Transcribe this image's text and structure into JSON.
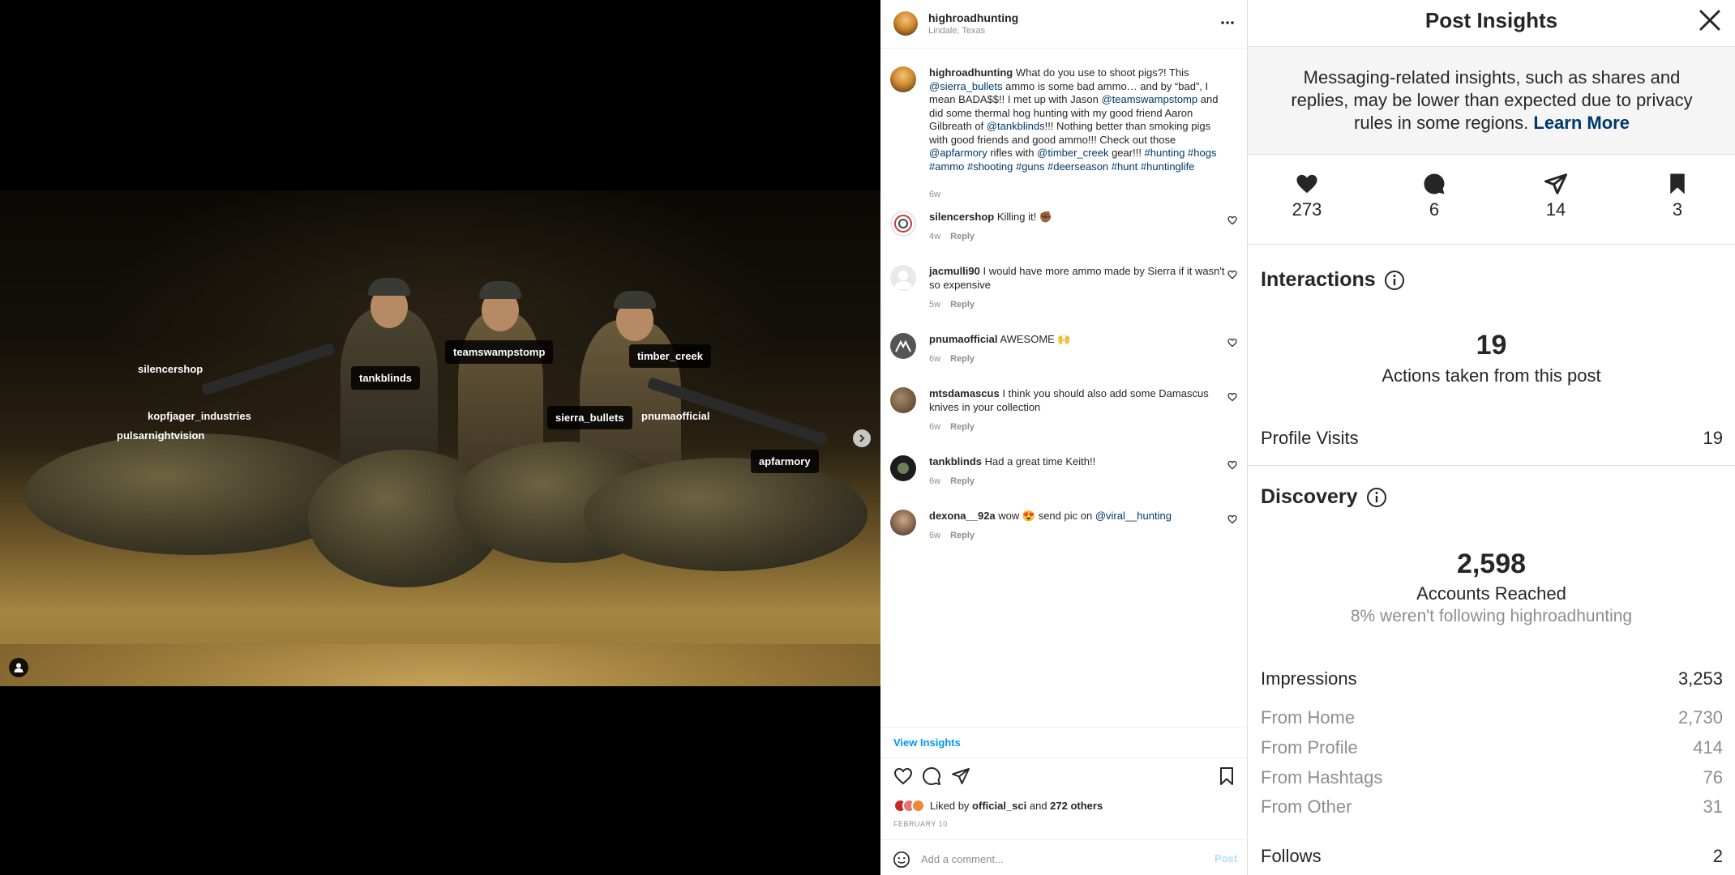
{
  "photo": {
    "tags": [
      {
        "label": "silencershop"
      },
      {
        "label": "tankblinds"
      },
      {
        "label": "teamswampstomp"
      },
      {
        "label": "timber_creek"
      },
      {
        "label": "kopfjager_industries"
      },
      {
        "label": "pulsarnightvision"
      },
      {
        "label": "sierra_bullets"
      },
      {
        "label": "pnumaofficial"
      },
      {
        "label": "apfarmory"
      }
    ],
    "next_icon": "chevron-right-icon",
    "user_tag_icon": "person-icon"
  },
  "post": {
    "username": "highroadhunting",
    "location": "Lindale, Texas",
    "more_icon": "more-horizontal-icon",
    "caption": {
      "username": "highroadhunting",
      "parts": [
        {
          "t": " What do you use to shoot pigs?! This "
        },
        {
          "t": "@sierra_bullets",
          "m": true
        },
        {
          "t": " ammo is some bad ammo… and by “bad”, I mean BADA$$!! I met up with Jason "
        },
        {
          "t": "@teamswampstomp",
          "m": true
        },
        {
          "t": " and did some thermal hog hunting with my good friend Aaron Gilbreath of "
        },
        {
          "t": "@tankblinds",
          "m": true
        },
        {
          "t": "!!! Nothing better than smoking pigs with good friends and good ammo!!! Check out those "
        },
        {
          "t": "@apfarmory",
          "m": true
        },
        {
          "t": " rifles with "
        },
        {
          "t": "@timber_creek",
          "m": true
        },
        {
          "t": " gear!!! "
        },
        {
          "t": "#hunting #hogs #ammo #shooting #guns #deerseason #hunt #huntinglife",
          "m": true
        }
      ],
      "time": "6w"
    },
    "comments": [
      {
        "user": "silencershop",
        "text": " Killing it! ✊🏾",
        "time": "4w",
        "reply": "Reply"
      },
      {
        "user": "jacmulli90",
        "text": " I would have more ammo made by Sierra if it wasn't so expensive",
        "time": "5w",
        "reply": "Reply"
      },
      {
        "user": "pnumaofficial",
        "text": " AWESOME 🙌",
        "time": "6w",
        "reply": "Reply"
      },
      {
        "user": "mtsdamascus",
        "text": " I think you should also add some Damascus knives in your collection",
        "time": "6w",
        "reply": "Reply"
      },
      {
        "user": "tankblinds",
        "text": " Had a great time Keith!!",
        "time": "6w",
        "reply": "Reply"
      },
      {
        "user": "dexona__92a",
        "text": " wow 😍 send pic on ",
        "mention": "@viral__hunting",
        "time": "6w",
        "reply": "Reply"
      }
    ],
    "view_insights": "View Insights",
    "likes": {
      "prefix": "Liked by ",
      "first": "official_sci",
      "mid": " and ",
      "others": "272 others"
    },
    "date": "FEBRUARY 10",
    "comment_placeholder": "Add a comment...",
    "post_button": "Post"
  },
  "insights": {
    "title": "Post Insights",
    "notice": "Messaging-related insights, such as shares and replies, may be lower than expected due to privacy rules in some regions.",
    "notice_link": "Learn More",
    "stats": [
      {
        "icon": "heart-icon",
        "value": "273"
      },
      {
        "icon": "comment-icon",
        "value": "6"
      },
      {
        "icon": "share-icon",
        "value": "14"
      },
      {
        "icon": "bookmark-icon",
        "value": "3"
      }
    ],
    "interactions": {
      "title": "Interactions",
      "total": "19",
      "total_label": "Actions taken from this post",
      "profile_visits_label": "Profile Visits",
      "profile_visits": "19"
    },
    "discovery": {
      "title": "Discovery",
      "reached": "2,598",
      "reached_label": "Accounts Reached",
      "reached_sub": "8% weren't following highroadhunting",
      "impressions_label": "Impressions",
      "impressions": "3,253",
      "sources": [
        {
          "label": "From Home",
          "value": "2,730"
        },
        {
          "label": "From Profile",
          "value": "414"
        },
        {
          "label": "From Hashtags",
          "value": "76"
        },
        {
          "label": "From Other",
          "value": "31"
        }
      ],
      "follows_label": "Follows",
      "follows": "2"
    }
  }
}
